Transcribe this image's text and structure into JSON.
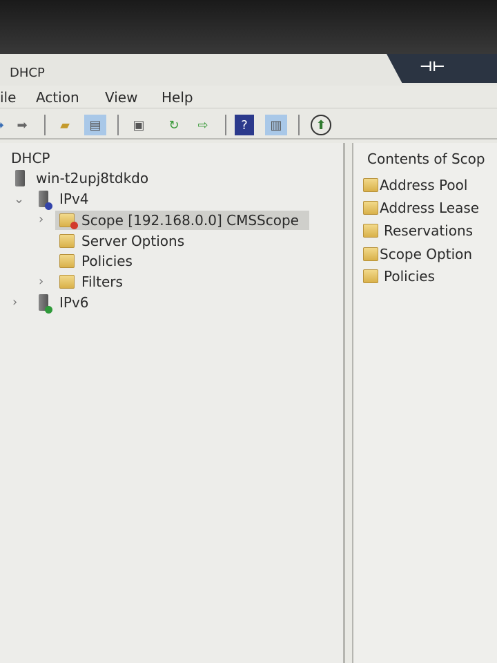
{
  "window": {
    "title": "DHCP",
    "pin_icon": "pin-icon"
  },
  "menu": [
    "ile",
    "Action",
    "View",
    "Help"
  ],
  "toolbar": [
    "back-icon",
    "forward-icon",
    "up-folder-icon",
    "show-hide-tree-icon",
    "properties-icon",
    "refresh-icon",
    "export-list-icon",
    "help-icon",
    "show-hide-action-pane-icon",
    "activate-icon"
  ],
  "tree": {
    "root": "DHCP",
    "server": "win-t2upj8tdkdo",
    "ipv4": "IPv4",
    "scope": "Scope [192.168.0.0] CMSScope",
    "server_options": "Server Options",
    "policies": "Policies",
    "filters": "Filters",
    "ipv6": "IPv6"
  },
  "contents": {
    "header": "Contents of Scop",
    "items": [
      "Address Pool",
      "Address Lease",
      "Reservations",
      "Scope Option",
      "Policies"
    ]
  },
  "colors": {
    "selection": "#cfcfcb",
    "folder": "#e3c064",
    "title_tab": "#2b3442"
  }
}
